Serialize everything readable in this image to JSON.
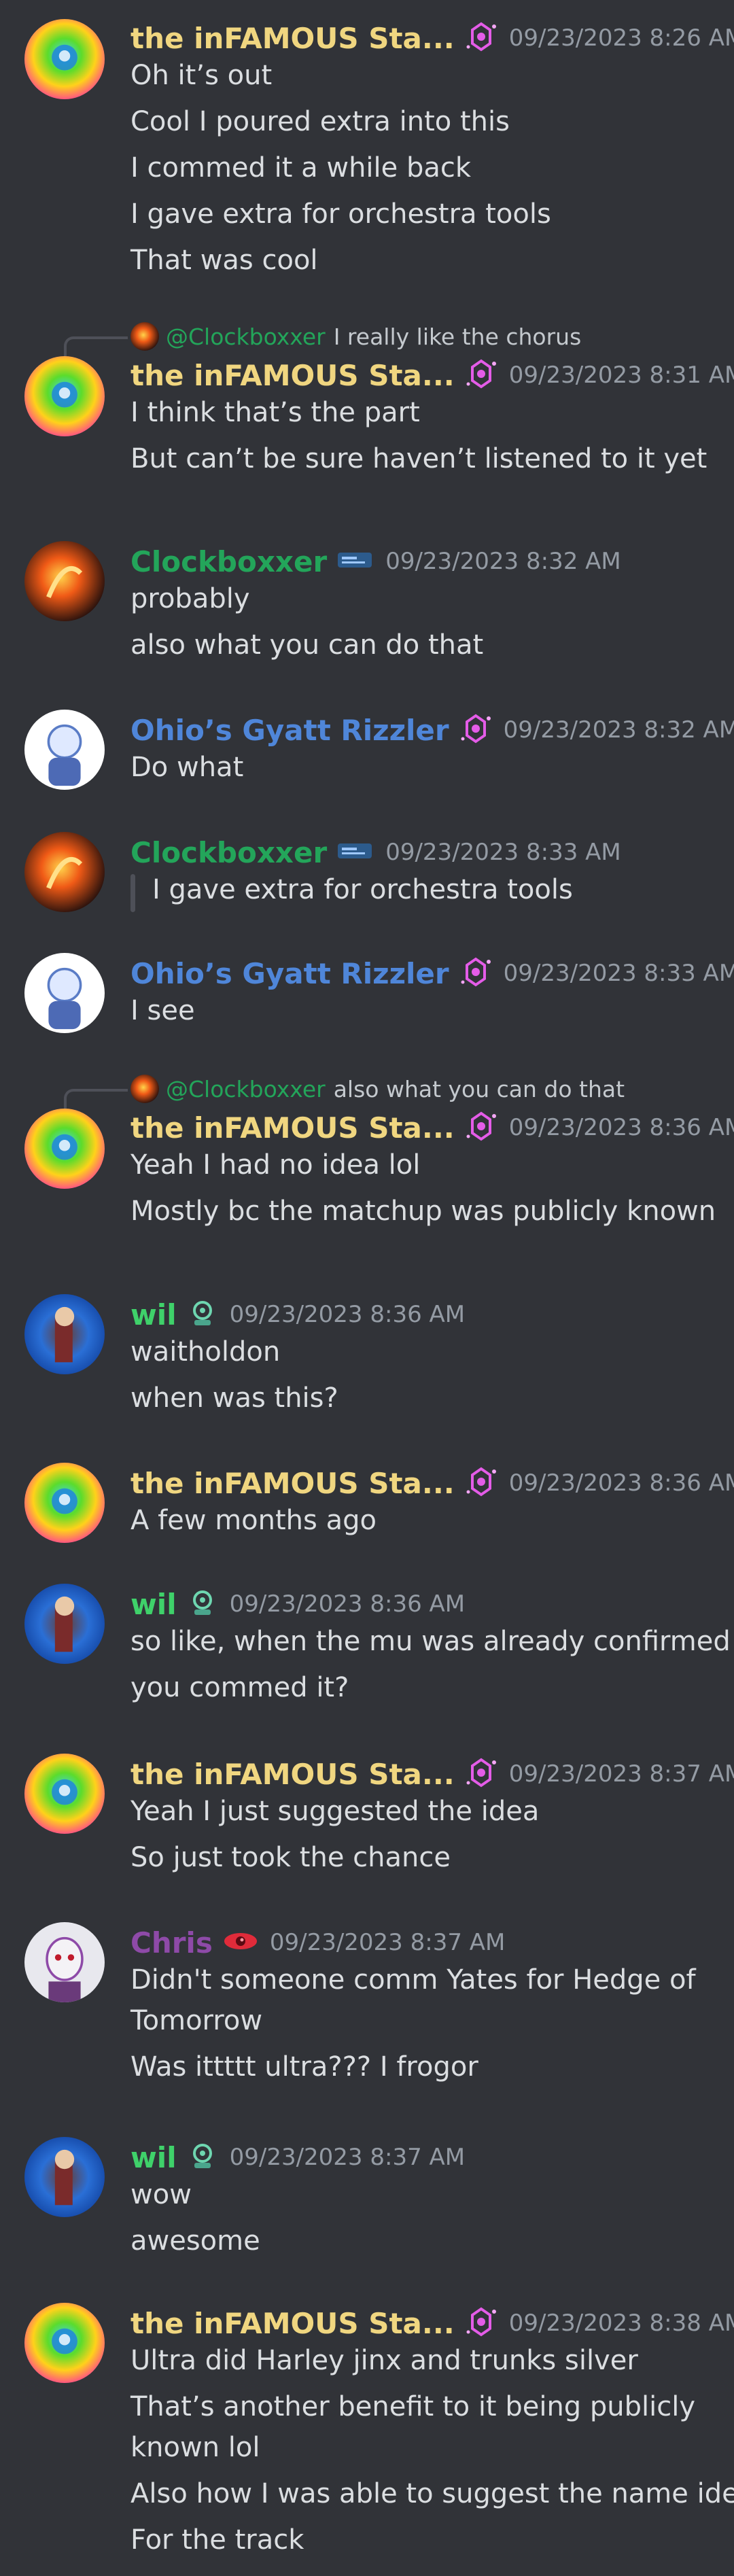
{
  "users": {
    "infamous": "the inFAMOUS Sta...",
    "clock": "Clockboxxer",
    "ohio": "Ohio’s Gyatt Rizzler",
    "wil": "wil",
    "chris": "Chris"
  },
  "messages": [
    {
      "ts": "09/23/2023 8:26 AM",
      "lines": [
        "Oh it’s out",
        "Cool I poured extra into this",
        "I commed it a while back",
        "I gave extra for orchestra tools",
        "That was cool"
      ]
    },
    {
      "reply_to": "@Clockboxxer",
      "reply_text": "I really like the chorus",
      "ts": "09/23/2023 8:31 AM",
      "lines": [
        "I think that’s the part",
        "But can’t be sure haven’t listened to it yet"
      ]
    },
    {
      "ts": "09/23/2023 8:32 AM",
      "lines": [
        "probably",
        "also what you can do that"
      ]
    },
    {
      "ts": "09/23/2023 8:32 AM",
      "lines": [
        "Do what"
      ]
    },
    {
      "ts": "09/23/2023 8:33 AM",
      "quote": "I gave extra for orchestra tools"
    },
    {
      "ts": "09/23/2023 8:33 AM",
      "lines": [
        "I see"
      ]
    },
    {
      "reply_to": "@Clockboxxer",
      "reply_text": "also what you can do that",
      "ts": "09/23/2023 8:36 AM",
      "lines": [
        "Yeah I had no idea lol",
        "Mostly bc the matchup was publicly known"
      ]
    },
    {
      "ts": "09/23/2023 8:36 AM",
      "lines": [
        "waitholdon",
        "when was this?"
      ]
    },
    {
      "ts": "09/23/2023 8:36 AM",
      "lines": [
        "A few months ago"
      ]
    },
    {
      "ts": "09/23/2023 8:36 AM",
      "lines": [
        "so like, when the mu was already confirmed",
        "you commed it?"
      ]
    },
    {
      "ts": "09/23/2023 8:37 AM",
      "lines": [
        "Yeah I just suggested the idea",
        "So just took the chance"
      ]
    },
    {
      "ts": "09/23/2023 8:37 AM",
      "lines": [
        "Didn't someone comm Yates for Hedge of",
        "Tomorrow",
        "Was ittttt ultra??? I frogor"
      ]
    },
    {
      "ts": "09/23/2023 8:37 AM",
      "lines": [
        "wow",
        "awesome"
      ]
    },
    {
      "ts": "09/23/2023 8:38 AM",
      "lines": [
        "Ultra did Harley jinx and trunks silver",
        "That’s another benefit to it being publicly",
        "known lol",
        "Also how I was able to suggest the name idea",
        "For the track"
      ]
    }
  ]
}
